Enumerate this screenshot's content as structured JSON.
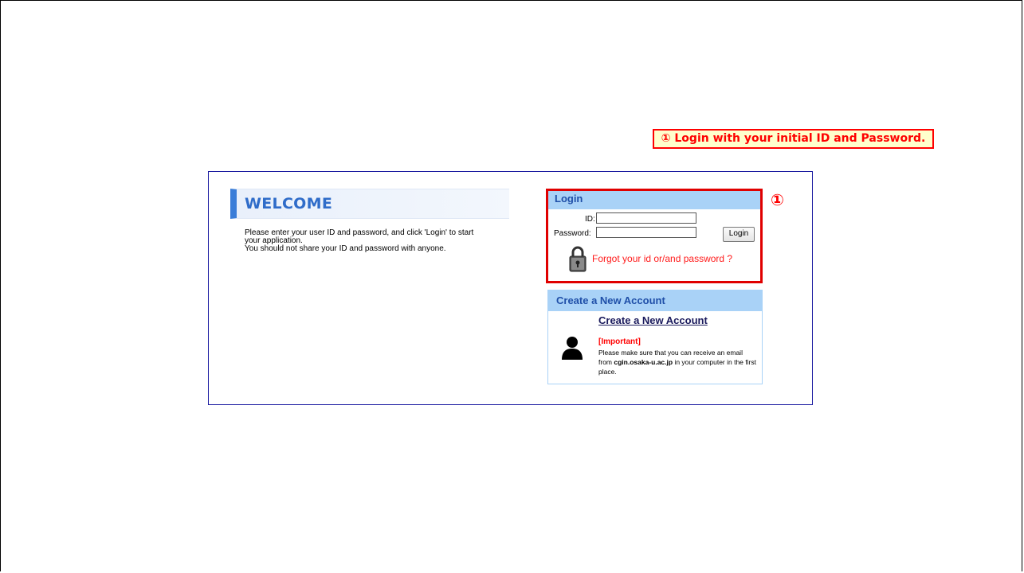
{
  "callout": {
    "text": "① Login with your initial ID and Password."
  },
  "welcome": {
    "title": "WELCOME",
    "lines": [
      "Please enter your user ID and password, and click 'Login' to start",
      "your application.",
      "You should not share your ID and password with anyone."
    ]
  },
  "login": {
    "header": "Login",
    "id_label": "ID:",
    "password_label": "Password:",
    "id_value": "",
    "password_value": "",
    "button_label": "Login",
    "forgot_text": "Forgot your id or/and password ?",
    "badge": "①"
  },
  "account": {
    "header": "Create a New Account",
    "link_text": "Create a New Account",
    "important_label": "[Important]",
    "notice_before": "Please make sure that you can receive an email from ",
    "notice_domain": "cgin.osaka-u.ac.jp",
    "notice_after": " in your computer in the first place."
  },
  "icons": {
    "lock": "padlock-icon",
    "person": "person-silhouette-icon"
  },
  "colors": {
    "accent": "#3a7dd8",
    "header_bg": "#a9d2f7",
    "highlight": "#ff0000"
  }
}
